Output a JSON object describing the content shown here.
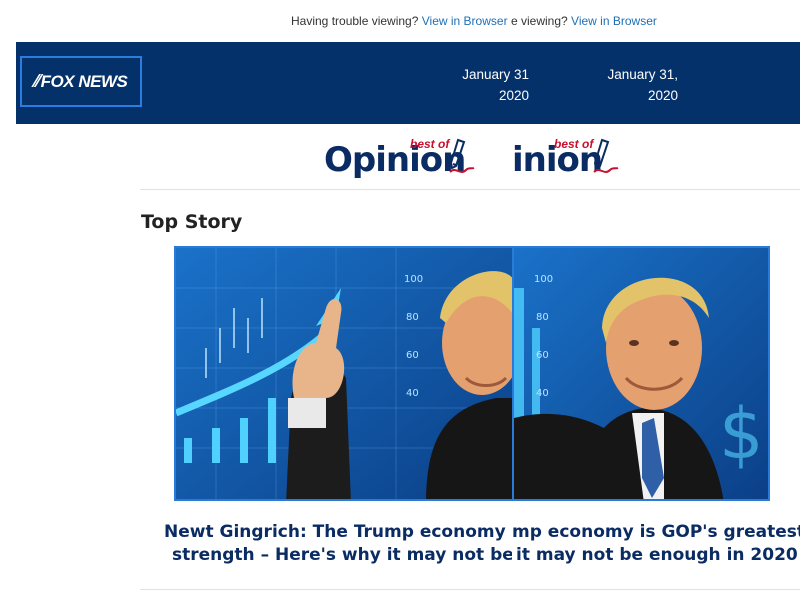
{
  "trouble": {
    "left_text": "Having trouble viewing?",
    "left_link": "View in Browser",
    "right_text": "e viewing?",
    "right_link": "View in Browser"
  },
  "header": {
    "logo": "FOX NEWS",
    "date_1_line1": "January 31",
    "date_1_line2": "2020",
    "date_2_line1": "January 31,",
    "date_2_line2": "2020"
  },
  "opinion": {
    "best_of": "best of",
    "word_1": "Opinion",
    "word_2": "inion"
  },
  "section": {
    "top_story": "Top Story"
  },
  "headline": {
    "left_line1": "Newt Gingrich: The Trump economy is (",
    "left_line2": "strength – Here's why it may not be en",
    "right_line1": "mp economy is GOP's greatest",
    "right_line2": "it may not be enough in 2020"
  },
  "colors": {
    "header_bg": "#043169",
    "link": "#1f6fb5",
    "headline": "#0a2c63",
    "best_of": "#c8102e"
  }
}
